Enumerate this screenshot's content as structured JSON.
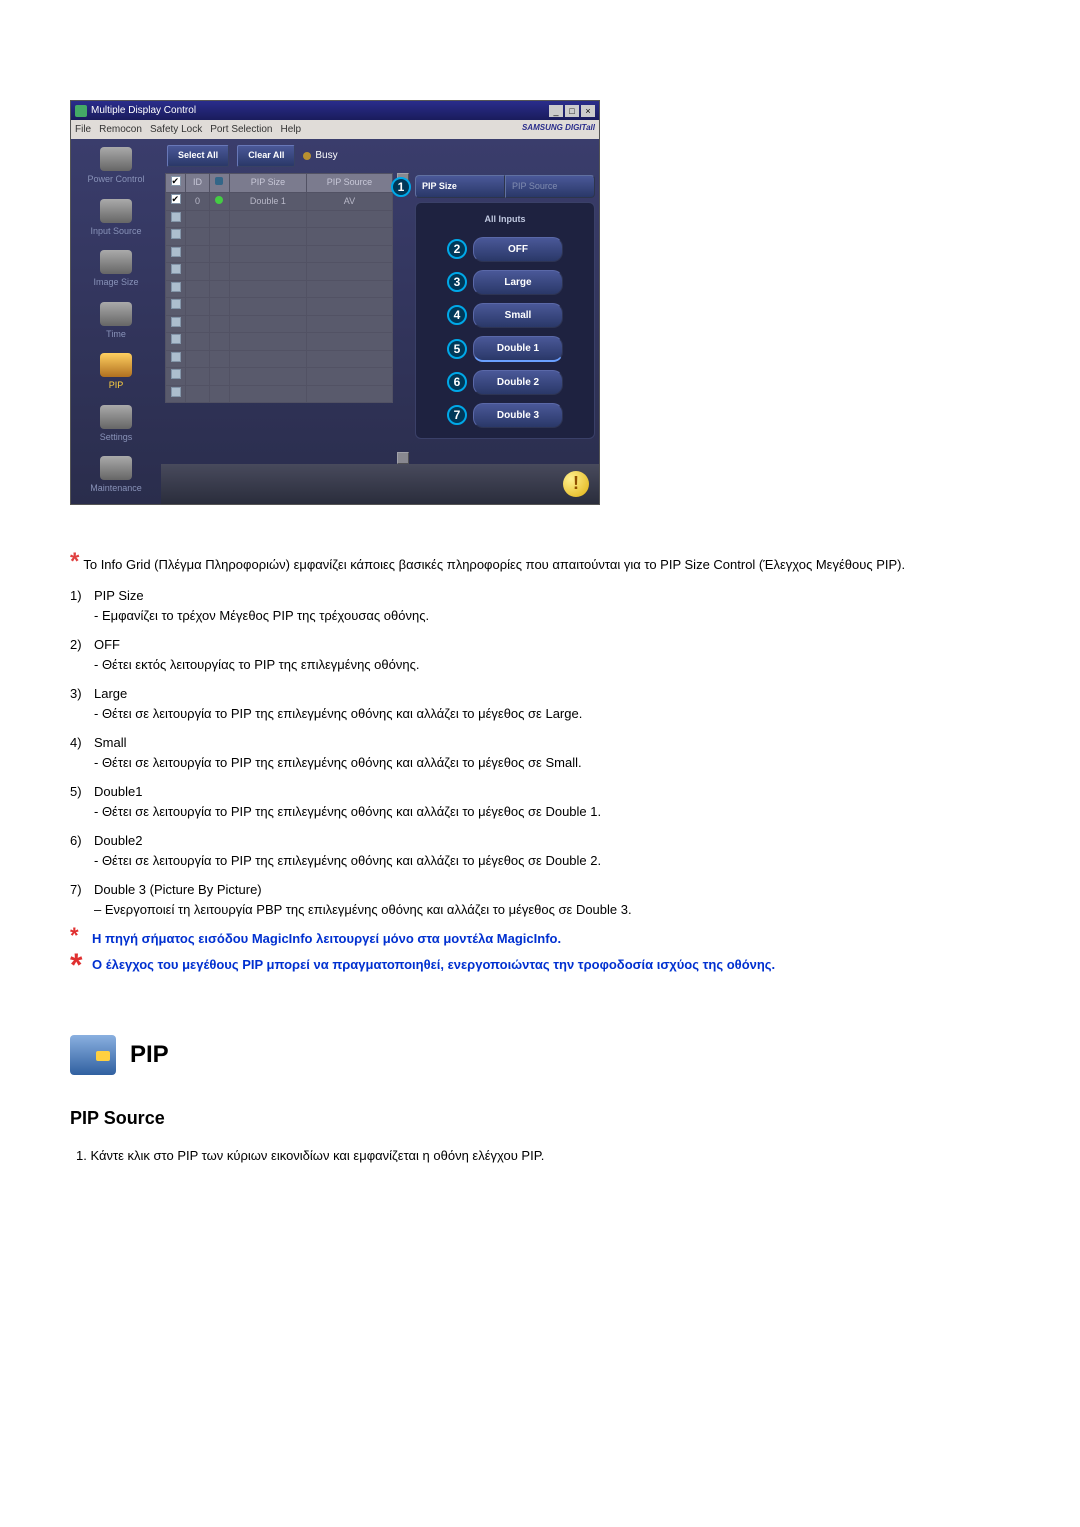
{
  "app_window": {
    "title": "Multiple Display Control",
    "menubar": [
      "File",
      "Remocon",
      "Safety Lock",
      "Port Selection",
      "Help"
    ],
    "brand": "SAMSUNG DIGITall",
    "toolbar": {
      "select_all": "Select All",
      "clear_all": "Clear All",
      "busy": "Busy"
    },
    "sidebar": [
      {
        "label": "Power Control"
      },
      {
        "label": "Input Source"
      },
      {
        "label": "Image Size"
      },
      {
        "label": "Time"
      },
      {
        "label": "PIP"
      },
      {
        "label": "Settings"
      },
      {
        "label": "Maintenance"
      }
    ],
    "table": {
      "headers": [
        "",
        "ID",
        "",
        "PIP Size",
        "PIP Source"
      ],
      "row0": {
        "id": "0",
        "pip_size": "Double 1",
        "pip_source": "AV"
      }
    },
    "right_panel": {
      "pip_size_label": "PIP Size",
      "pip_source_label": "PIP Source",
      "all_inputs": "All Inputs",
      "options": [
        "OFF",
        "Large",
        "Small",
        "Double 1",
        "Double 2",
        "Double 3"
      ]
    }
  },
  "doc": {
    "intro": "Το Info Grid (Πλέγμα Πληροφοριών) εμφανίζει κάποιες βασικές πληροφορίες που απαιτούνται για το PIP Size Control (Έλεγχος Μεγέθους PIP).",
    "items": [
      {
        "n": "1)",
        "title": "PIP Size",
        "desc": "- Εμφανίζει το τρέχον Μέγεθος PIP της τρέχουσας οθόνης."
      },
      {
        "n": "2)",
        "title": "OFF",
        "desc": "- Θέτει εκτός λειτουργίας το PIP της επιλεγμένης οθόνης."
      },
      {
        "n": "3)",
        "title": "Large",
        "desc": "- Θέτει σε λειτουργία το PIP της επιλεγμένης οθόνης και αλλάζει το μέγεθος σε Large."
      },
      {
        "n": "4)",
        "title": "Small",
        "desc": "- Θέτει σε λειτουργία το PIP της επιλεγμένης οθόνης και αλλάζει το μέγεθος σε Small."
      },
      {
        "n": "5)",
        "title": "Double1",
        "desc": "- Θέτει σε λειτουργία το PIP της επιλεγμένης οθόνης και αλλάζει το μέγεθος σε Double 1."
      },
      {
        "n": "6)",
        "title": "Double2",
        "desc": "- Θέτει σε λειτουργία το PIP της επιλεγμένης οθόνης και αλλάζει το μέγεθος σε Double 2."
      },
      {
        "n": "7)",
        "title": "Double 3 (Picture By Picture)",
        "desc": "– Ενεργοποιεί τη λειτουργία PBP της επιλεγμένης οθόνης και αλλάζει το μέγεθος σε Double 3."
      }
    ],
    "note1": "Η πηγή σήματος εισόδου MagicInfo λειτουργεί μόνο στα μοντέλα MagicInfo.",
    "note2": "Ο έλεγχος του μεγέθους PIP μπορεί να πραγματοποιηθεί, ενεργοποιώντας την τροφοδοσία ισχύος της οθόνης.",
    "pip_heading": "PIP",
    "pip_source_heading": "PIP Source",
    "pip_source_step": "1.  Κάντε κλικ στο PIP των κύριων εικονιδίων και εμφανίζεται η οθόνη ελέγχου PIP."
  }
}
